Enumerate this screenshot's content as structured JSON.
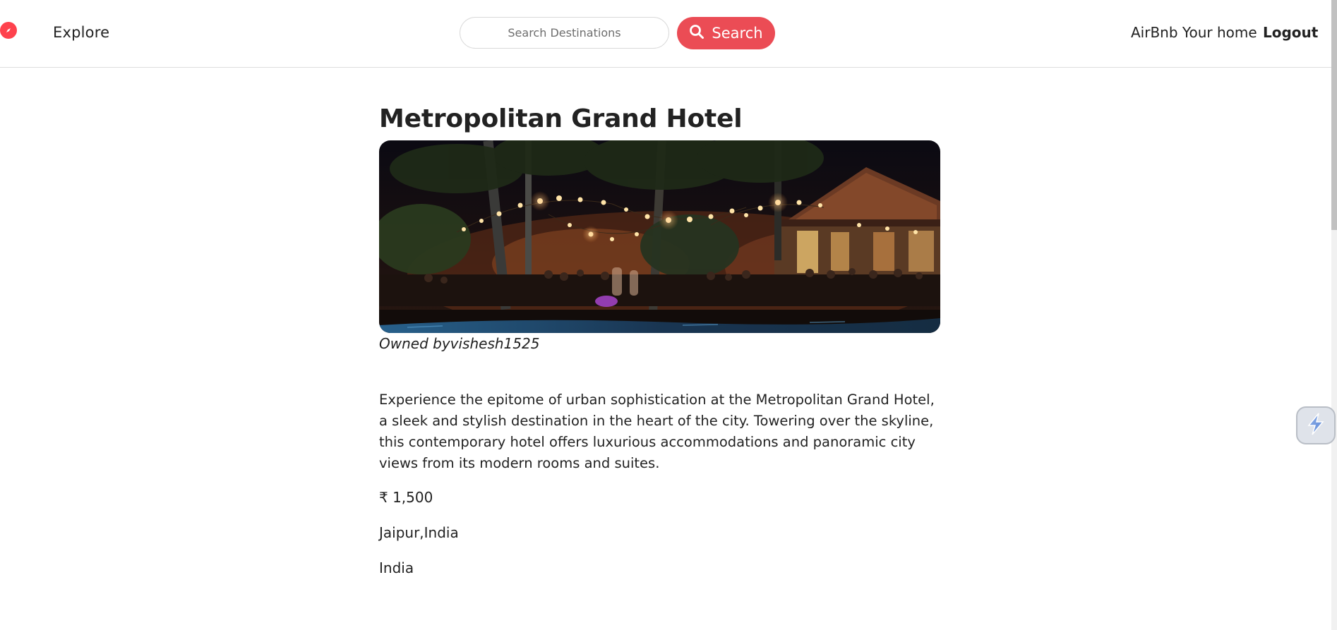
{
  "navbar": {
    "brand_icon": "compass-icon",
    "explore_label": "Explore",
    "search_placeholder": "Search Destinations",
    "search_value": "",
    "search_button_label": "Search",
    "search_button_icon": "search-icon",
    "home_label": "AirBnb Your home",
    "logout_label": "Logout"
  },
  "listing": {
    "title": "Metropolitan Grand Hotel",
    "image_alt": "Hotel courtyard at night with string lights, palm trees and diners",
    "owner_text": "Owned byvishesh1525",
    "description": "Experience the epitome of urban sophistication at the Metropolitan Grand Hotel, a sleek and stylish destination in the heart of the city. Towering over the skyline, this contemporary hotel offers luxurious accommodations and panoramic city views from its modern rooms and suites.",
    "price": "₹ 1,500",
    "location": "Jaipur,India",
    "country": "India"
  },
  "side_widget": {
    "icon": "lightning-icon"
  },
  "colors": {
    "accent": "#fe424d",
    "search_button": "#eb4c55",
    "text": "#222222",
    "border": "#dedede"
  }
}
